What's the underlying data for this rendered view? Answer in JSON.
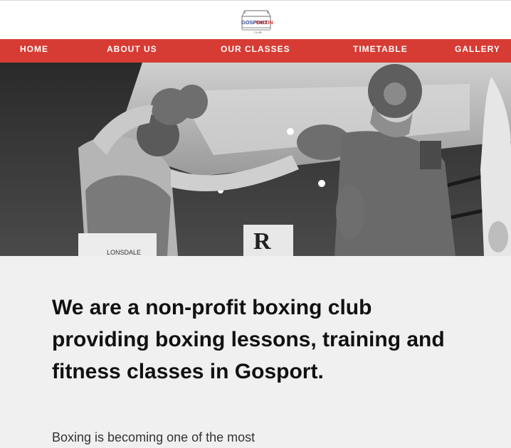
{
  "logo": {
    "top_text": "GOSPORT",
    "top_text_accent": "BOXING",
    "sub_text": "CLUB"
  },
  "nav": {
    "home": "HOME",
    "about": "ABOUT US",
    "classes": "OUR CLASSES",
    "timetable": "TIMETABLE",
    "gallery": "GALLERY"
  },
  "hero": {
    "sign_text": "R",
    "shorts_brand": "LONSDALE"
  },
  "intro": {
    "headline": "We are a non-profit boxing club providing boxing lessons, training and fitness classes in Gosport.",
    "paragraph": "Boxing is becoming one of the most"
  },
  "colors": {
    "nav_bg": "#d63c34",
    "page_bg": "#f0f0f0",
    "logo_red": "#d63c34",
    "logo_blue": "#2e4a8c"
  }
}
